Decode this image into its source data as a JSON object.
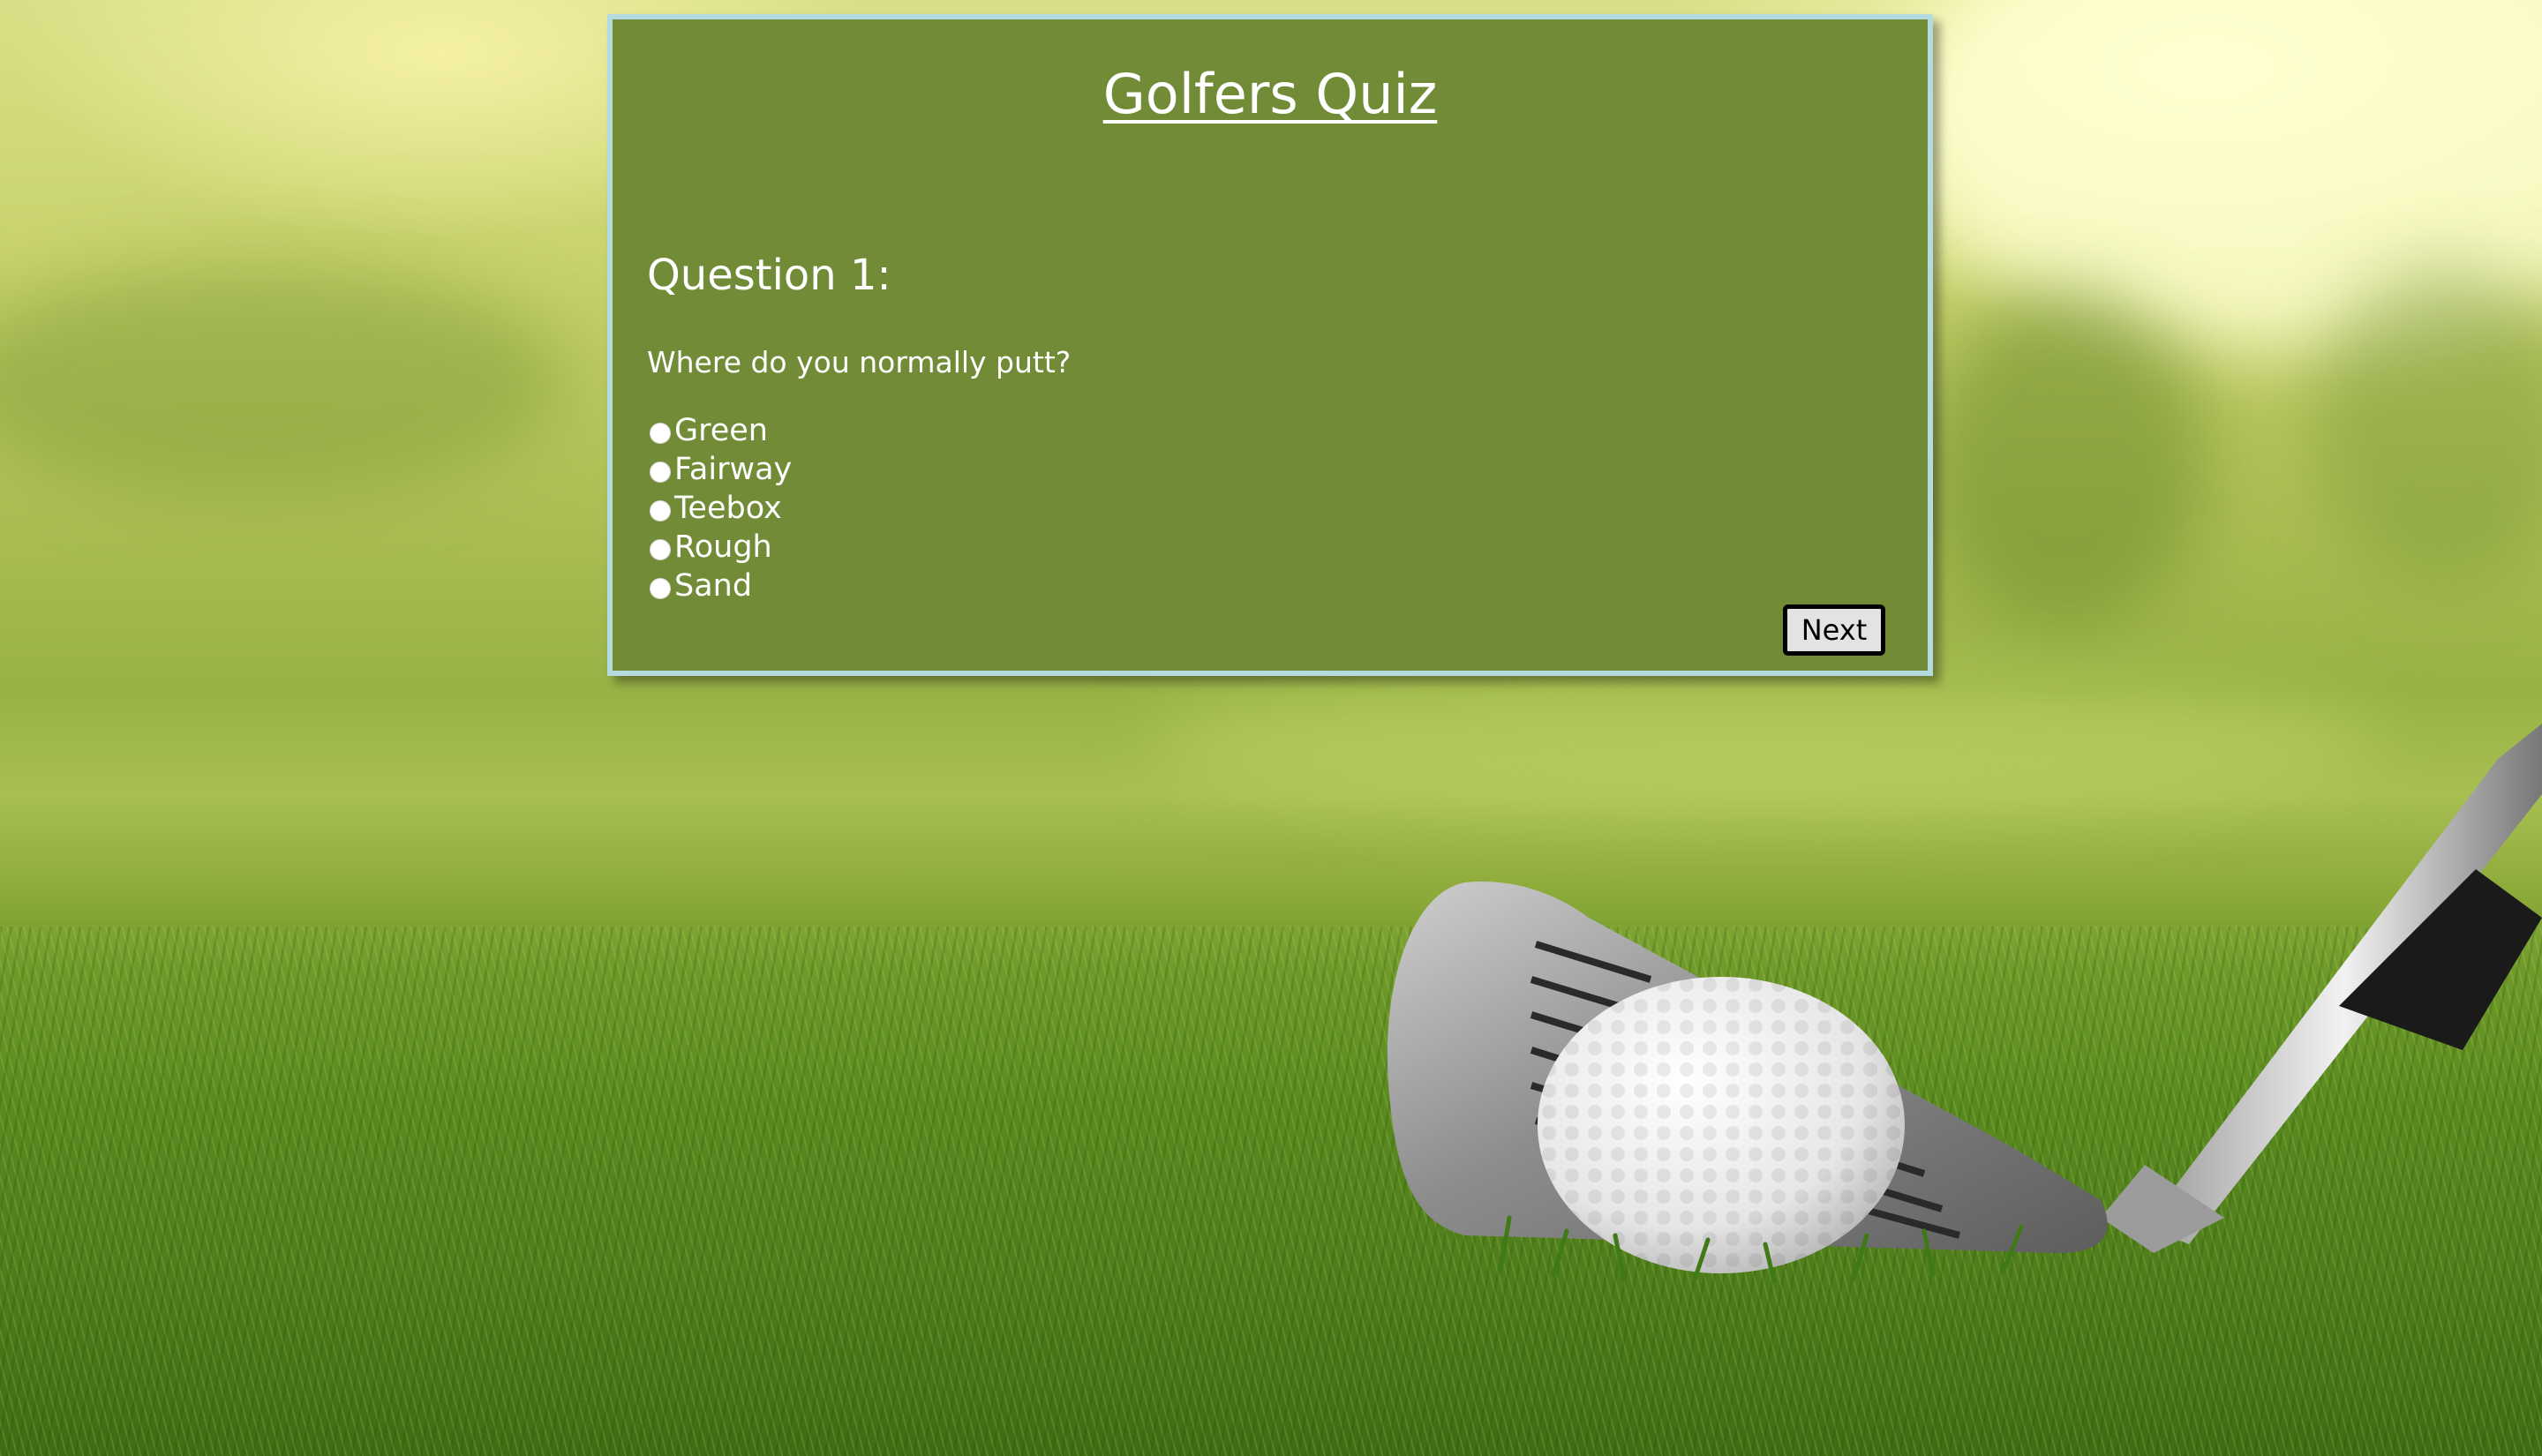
{
  "quiz": {
    "title": "Golfers Quiz",
    "question_heading": "Question 1:",
    "question_text": "Where do you normally putt?",
    "options": [
      {
        "label": "Green"
      },
      {
        "label": "Fairway"
      },
      {
        "label": "Teebox"
      },
      {
        "label": "Rough"
      },
      {
        "label": "Sand"
      }
    ],
    "next_label": "Next"
  },
  "colors": {
    "card_background": "#718b36",
    "card_border": "#b3dbe0",
    "text": "#ffffff",
    "button_background": "#e3e3e3",
    "button_border": "#000000"
  },
  "background": {
    "description_icon": "golf-ball-and-iron-on-grass-photo"
  }
}
